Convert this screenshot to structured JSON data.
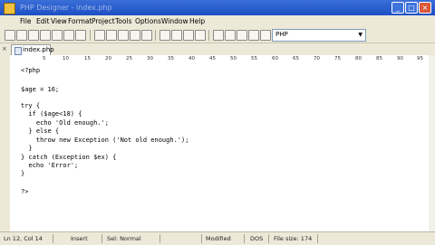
{
  "window": {
    "title": "PHP Designer - index.php"
  },
  "menu": [
    "File",
    "Edit",
    "View",
    "Format",
    "Project",
    "Tools",
    "Options",
    "Window",
    "Help"
  ],
  "toolbar": {
    "language": "PHP"
  },
  "tabs": [
    {
      "label": "index.php"
    }
  ],
  "ruler": {
    "labels": [
      "5",
      "10",
      "15",
      "20",
      "25",
      "30",
      "35",
      "40",
      "45",
      "50",
      "55",
      "60",
      "65",
      "70",
      "75",
      "80",
      "85",
      "90",
      "95"
    ]
  },
  "code": [
    "<?php",
    "",
    "$age = 16;",
    "",
    "try {",
    "  if ($age<18) {",
    "    echo 'Old enough.';",
    "  } else {",
    "    throw new Exception ('Not old enough.');",
    "  }",
    "} catch (Exception $ex) {",
    "  echo 'Error';",
    "}",
    "",
    "?>"
  ],
  "status": {
    "position": "Ln 12, Col 14",
    "mode": "Insert",
    "selection": "Sel: Normal",
    "modified": "Modified",
    "line_endings": "DOS",
    "file_size": "File size: 174"
  }
}
